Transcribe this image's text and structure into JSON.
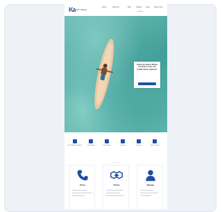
{
  "header": {
    "logo_mark": "Ka",
    "logo_text": "Kai Trading",
    "nav": [
      "Home",
      "About Us",
      "Products",
      "FAQ",
      "Contact",
      "Login",
      "Other Links"
    ]
  },
  "hero": {
    "info_text": "Online Kit attains Mobile innovation Learn the Collaborative engineers"
  },
  "services": [
    {
      "label": "Kai-Trading Products"
    },
    {
      "label": "Download"
    },
    {
      "label": "Certificates"
    },
    {
      "label": "Contact"
    },
    {
      "label": "Partner"
    },
    {
      "label": "Service Point"
    }
  ],
  "pagination_dots": "• • •",
  "contacts": [
    {
      "title": "Phone",
      "icon": "phone-icon"
    },
    {
      "title": "Partner",
      "icon": "handshake-icon"
    },
    {
      "title": "Manager",
      "icon": "person-icon"
    }
  ],
  "colors": {
    "brand": "#1e4fa3",
    "sea": "#4fa9a3"
  }
}
